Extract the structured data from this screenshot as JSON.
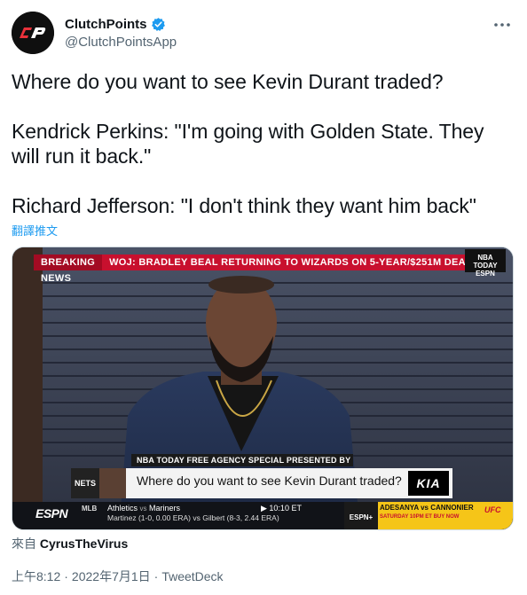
{
  "author": {
    "display_name": "ClutchPoints",
    "handle": "@ClutchPointsApp",
    "avatar_text": "CP"
  },
  "tweet": {
    "paragraphs": [
      "Where do you want to see Kevin Durant traded?",
      "Kendrick Perkins: \"I'm going with Golden State. They will run it back.\"",
      "Richard Jefferson: \"I don't think they want him back\""
    ],
    "translate_label": "翻譯推文"
  },
  "media": {
    "breaking_label": "BREAKING NEWS",
    "ticker_headline": "WOJ: BRADLEY BEAL RETURNING TO WIZARDS ON 5-YEAR/$251M DEAL",
    "show_logo_lines": [
      "NBA",
      "TODAY",
      "ESPN"
    ],
    "lower_third_label": "NBA TODAY FREE AGENCY SPECIAL PRESENTED BY KIA",
    "nets_badge": "NETS",
    "lower_third_question": "Where do you want to see Kevin Durant traded?",
    "kia_logo": "KIA",
    "network_logo": "ESPN",
    "league": "MLB",
    "team_away": "Athletics",
    "vs": "vs",
    "team_home": "Mariners",
    "game_time": "▶ 10:10 ET",
    "pitchers": "Martinez (1-0, 0.00 ERA) vs Gilbert (8-3, 2.44 ERA)",
    "promo_network": "ESPN+",
    "promo_title": "ADESANYA vs CANNONIER",
    "promo_subtitle": "SATURDAY 10PM ET BUY NOW",
    "promo_brand": "UFC"
  },
  "source": {
    "prefix": "來自",
    "name": "CyrusTheVirus"
  },
  "meta": {
    "time": "上午8:12",
    "separator": "·",
    "date": "2022年7月1日",
    "app": "TweetDeck"
  },
  "colors": {
    "link_blue": "#1d9bf0",
    "muted_gray": "#536471",
    "ticker_red": "#c8102e",
    "verified_blue": "#1d9bf0"
  }
}
